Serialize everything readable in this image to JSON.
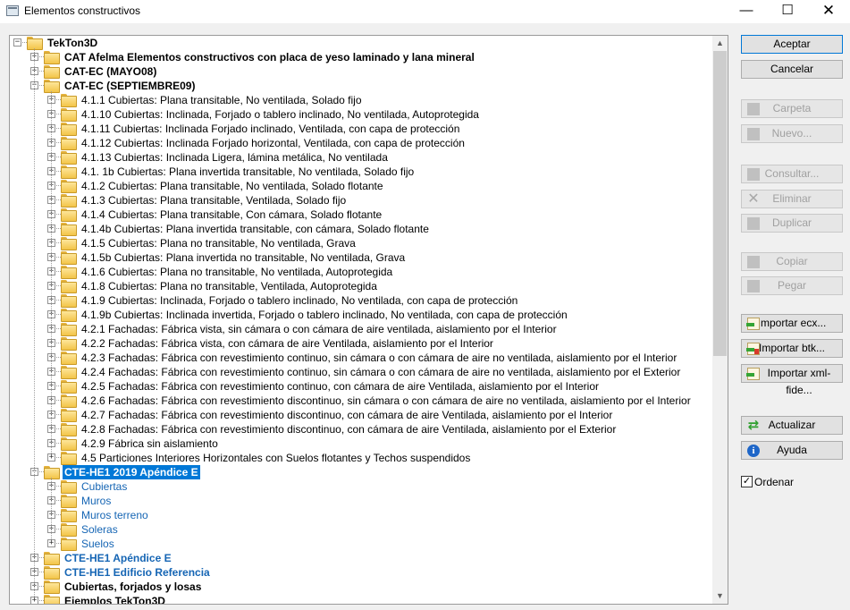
{
  "window": {
    "title": "Elementos constructivos",
    "minimize": "—",
    "maximize": "☐",
    "close": "✕"
  },
  "tree": [
    {
      "label": "TekTon3D",
      "level": 0,
      "expanded": true
    },
    {
      "label": "CAT Afelma Elementos constructivos con placa de yeso laminado y lana mineral",
      "level": 1,
      "expanded": false
    },
    {
      "label": "CAT-EC (MAYO08)",
      "level": 1,
      "expanded": false
    },
    {
      "label": "CAT-EC (SEPTIEMBRE09)",
      "level": 1,
      "expanded": true
    },
    {
      "label": "4.1.1 Cubiertas: Plana transitable, No ventilada, Solado fijo",
      "level": 2
    },
    {
      "label": "4.1.10 Cubiertas: Inclinada, Forjado o tablero inclinado, No ventilada, Autoprotegida",
      "level": 2
    },
    {
      "label": "4.1.11 Cubiertas: Inclinada Forjado inclinado, Ventilada, con capa de protección",
      "level": 2
    },
    {
      "label": "4.1.12 Cubiertas: Inclinada Forjado horizontal, Ventilada, con capa de protección",
      "level": 2
    },
    {
      "label": "4.1.13 Cubiertas: Inclinada Ligera,  lámina metálica, No ventilada",
      "level": 2
    },
    {
      "label": "4.1. 1b Cubiertas: Plana invertida transitable, No ventilada, Solado fijo",
      "level": 2
    },
    {
      "label": "4.1.2 Cubiertas: Plana transitable, No ventilada, Solado flotante",
      "level": 2
    },
    {
      "label": "4.1.3 Cubiertas: Plana transitable, Ventilada, Solado fijo",
      "level": 2
    },
    {
      "label": "4.1.4 Cubiertas: Plana transitable, Con cámara, Solado flotante",
      "level": 2
    },
    {
      "label": "4.1.4b Cubiertas: Plana invertida transitable, con cámara, Solado flotante",
      "level": 2
    },
    {
      "label": "4.1.5 Cubiertas: Plana no transitable, No ventilada, Grava",
      "level": 2
    },
    {
      "label": "4.1.5b Cubiertas: Plana invertida no transitable, No ventilada, Grava",
      "level": 2
    },
    {
      "label": "4.1.6 Cubiertas: Plana no transitable, No ventilada, Autoprotegida",
      "level": 2
    },
    {
      "label": "4.1.8 Cubiertas: Plana no transitable, Ventilada, Autoprotegida",
      "level": 2
    },
    {
      "label": "4.1.9 Cubiertas: Inclinada, Forjado o tablero inclinado, No ventilada, con capa de protección",
      "level": 2
    },
    {
      "label": "4.1.9b Cubiertas: Inclinada invertida, Forjado o tablero inclinado, No ventilada, con capa de protección",
      "level": 2
    },
    {
      "label": "4.2.1 Fachadas: Fábrica vista, sin cámara o con cámara de aire ventilada, aislamiento  por el Interior",
      "level": 2
    },
    {
      "label": "4.2.2 Fachadas: Fábrica vista, con cámara de aire Ventilada, aislamiento  por el Interior",
      "level": 2
    },
    {
      "label": "4.2.3 Fachadas: Fábrica con revestimiento continuo, sin cámara o con cámara de aire no ventilada, aislamiento  por el Interior",
      "level": 2
    },
    {
      "label": "4.2.4 Fachadas: Fábrica con revestimiento continuo, sin cámara o con cámara de aire no ventilada, aislamiento  por el Exterior",
      "level": 2
    },
    {
      "label": "4.2.5 Fachadas: Fábrica con revestimiento continuo, con cámara de aire Ventilada, aislamiento por el Interior",
      "level": 2
    },
    {
      "label": "4.2.6 Fachadas: Fábrica con revestimiento discontinuo, sin cámara o con cámara de aire no ventilada, aislamiento por el Interior",
      "level": 2
    },
    {
      "label": "4.2.7 Fachadas: Fábrica con revestimiento discontinuo, con cámara de aire Ventilada, aislamiento por el Interior",
      "level": 2
    },
    {
      "label": "4.2.8 Fachadas: Fábrica con revestimiento discontinuo, con cámara de aire Ventilada, aislamiento por el Exterior",
      "level": 2
    },
    {
      "label": "4.2.9 Fábrica sin aislamiento",
      "level": 2
    },
    {
      "label": "4.5  Particiones Interiores Horizontales con Suelos flotantes y Techos suspendidos",
      "level": 2
    },
    {
      "label": "CTE-HE1 2019 Apéndice E",
      "level": 1,
      "expanded": true,
      "blue": true,
      "selected": true
    },
    {
      "label": "Cubiertas",
      "level": 2,
      "blue": true
    },
    {
      "label": "Muros",
      "level": 2,
      "blue": true
    },
    {
      "label": "Muros terreno",
      "level": 2,
      "blue": true
    },
    {
      "label": "Soleras",
      "level": 2,
      "blue": true
    },
    {
      "label": "Suelos",
      "level": 2,
      "blue": true
    },
    {
      "label": "CTE-HE1 Apéndice E",
      "level": 1,
      "expanded": false,
      "blue": true
    },
    {
      "label": "CTE-HE1 Edificio Referencia",
      "level": 1,
      "expanded": false,
      "blue": true
    },
    {
      "label": "Cubiertas, forjados y losas",
      "level": 1,
      "expanded": false
    },
    {
      "label": "Ejemplos TekTon3D",
      "level": 1,
      "expanded": false
    }
  ],
  "scrollbar": {
    "up": "▲",
    "down": "▼"
  },
  "buttons": {
    "aceptar": "Aceptar",
    "cancelar": "Cancelar",
    "carpeta": "Carpeta",
    "nuevo": "Nuevo...",
    "consultar": "Consultar...",
    "eliminar": "Eliminar",
    "duplicar": "Duplicar",
    "copiar": "Copiar",
    "pegar": "Pegar",
    "importar_ecx": "Importar ecx...",
    "importar_btk": "Importar btk...",
    "importar_xml": "Importar xml-fide...",
    "actualizar": "Actualizar",
    "ayuda": "Ayuda"
  },
  "icons": {
    "eliminar": "✕",
    "actualizar": "⇄",
    "ayuda": "i"
  },
  "ordenar": {
    "label": "Ordenar",
    "checked": true,
    "mark": "✓"
  }
}
